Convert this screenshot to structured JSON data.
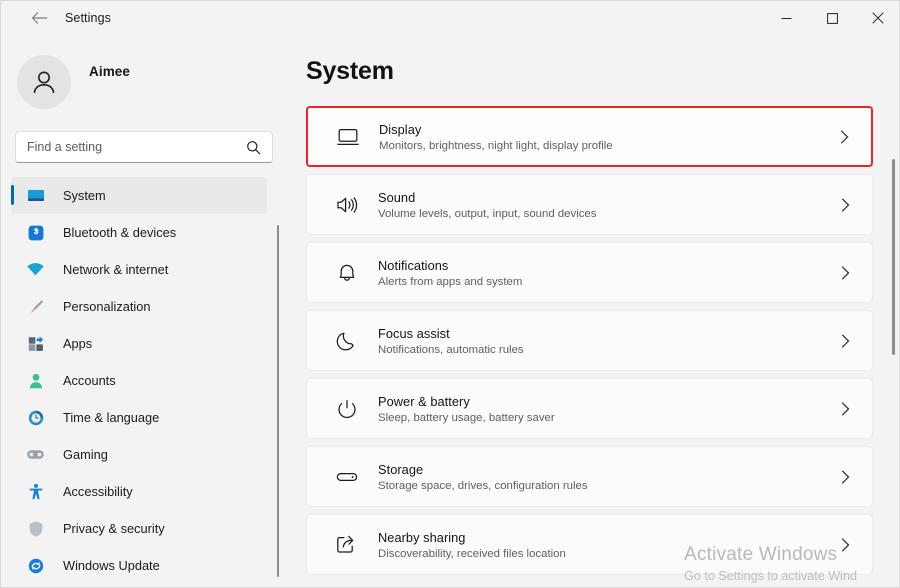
{
  "window": {
    "app_title": "Settings",
    "back_icon": "arrow-left-icon",
    "controls": [
      {
        "name": "minimize-button",
        "icon": "minimize-icon"
      },
      {
        "name": "maximize-button",
        "icon": "maximize-icon"
      },
      {
        "name": "close-button",
        "icon": "close-icon"
      }
    ]
  },
  "sidebar": {
    "profile": {
      "name": "Aimee",
      "sub": "",
      "avatar_icon": "person-icon"
    },
    "search": {
      "placeholder": "Find a setting",
      "value": "",
      "icon": "search-icon"
    },
    "items": [
      {
        "label": "System",
        "icon": "monitor-icon",
        "selected": true
      },
      {
        "label": "Bluetooth & devices",
        "icon": "bluetooth-icon",
        "selected": false
      },
      {
        "label": "Network & internet",
        "icon": "wifi-icon",
        "selected": false
      },
      {
        "label": "Personalization",
        "icon": "paintbrush-icon",
        "selected": false
      },
      {
        "label": "Apps",
        "icon": "apps-icon",
        "selected": false
      },
      {
        "label": "Accounts",
        "icon": "account-icon",
        "selected": false
      },
      {
        "label": "Time & language",
        "icon": "clock-icon",
        "selected": false
      },
      {
        "label": "Gaming",
        "icon": "gamepad-icon",
        "selected": false
      },
      {
        "label": "Accessibility",
        "icon": "accessibility-icon",
        "selected": false
      },
      {
        "label": "Privacy & security",
        "icon": "shield-icon",
        "selected": false
      },
      {
        "label": "Windows Update",
        "icon": "update-icon",
        "selected": false
      }
    ]
  },
  "main": {
    "page_title": "System",
    "cards": [
      {
        "title": "Display",
        "sub": "Monitors, brightness, night light, display profile",
        "icon": "display-icon",
        "highlighted": true
      },
      {
        "title": "Sound",
        "sub": "Volume levels, output, input, sound devices",
        "icon": "speaker-icon",
        "highlighted": false
      },
      {
        "title": "Notifications",
        "sub": "Alerts from apps and system",
        "icon": "bell-icon",
        "highlighted": false
      },
      {
        "title": "Focus assist",
        "sub": "Notifications, automatic rules",
        "icon": "moon-icon",
        "highlighted": false
      },
      {
        "title": "Power & battery",
        "sub": "Sleep, battery usage, battery saver",
        "icon": "power-icon",
        "highlighted": false
      },
      {
        "title": "Storage",
        "sub": "Storage space, drives, configuration rules",
        "icon": "drive-icon",
        "highlighted": false
      },
      {
        "title": "Nearby sharing",
        "sub": "Discoverability, received files location",
        "icon": "share-icon",
        "highlighted": false
      }
    ]
  },
  "watermark": {
    "title": "Activate Windows",
    "subtitle": "Go to Settings to activate Wind"
  },
  "colors": {
    "accent": "#0067c0",
    "highlight_border": "#e8252a",
    "window_bg": "#f3f3f3",
    "card_bg": "#fbfbfb"
  }
}
